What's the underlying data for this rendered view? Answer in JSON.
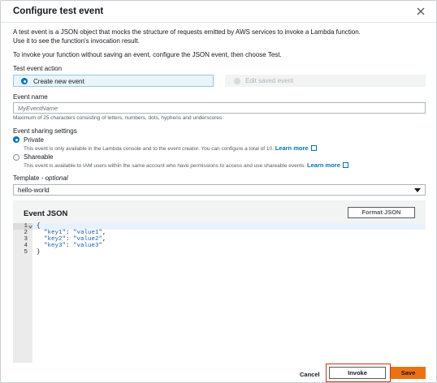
{
  "dialog": {
    "title": "Configure test event",
    "intro_line1": "A test event is a JSON object that mocks the structure of requests emitted by AWS services to invoke a Lambda function.",
    "intro_line2": "Use it to see the function's invocation result.",
    "intro_line3": "To invoke your function without saving an event, configure the JSON event, then choose Test."
  },
  "event_action": {
    "label": "Test event action",
    "options": [
      {
        "label": "Create new event",
        "selected": true
      },
      {
        "label": "Edit saved event",
        "disabled": true
      }
    ]
  },
  "event_name": {
    "label": "Event name",
    "placeholder": "MyEventName",
    "value": "",
    "hint": "Maximum of 25 characters consisting of letters, numbers, dots, hyphens and underscores."
  },
  "sharing": {
    "label": "Event sharing settings",
    "options": [
      {
        "label": "Private",
        "selected": true,
        "description": "This event is only available in the Lambda console and to the event creator. You can configure a total of 10.",
        "link": "Learn more"
      },
      {
        "label": "Shareable",
        "selected": false,
        "description": "This event is available to IAM users within the same account who have permissions to access and use shareable events.",
        "link": "Learn more"
      }
    ]
  },
  "template": {
    "label": "Template",
    "optional_label": "optional",
    "selected": "hello-world"
  },
  "event_json": {
    "title": "Event JSON",
    "format_button": "Format JSON",
    "line_numbers": [
      "1",
      "2",
      "3",
      "4",
      "5"
    ],
    "lines": [
      {
        "plain": "{"
      },
      {
        "key": "\"key1\"",
        "sep": ": ",
        "val": "\"value1\"",
        "end": ","
      },
      {
        "key": "\"key2\"",
        "sep": ": ",
        "val": "\"value2\"",
        "end": ","
      },
      {
        "key": "\"key3\"",
        "sep": ": ",
        "val": "\"value3\"",
        "end": ""
      },
      {
        "plain": "}"
      }
    ]
  },
  "footer": {
    "cancel": "Cancel",
    "invoke": "Invoke",
    "save": "Save"
  },
  "colors": {
    "accent": "#0073bb",
    "primary_button": "#ec7211",
    "highlight_box": "#d13212"
  }
}
